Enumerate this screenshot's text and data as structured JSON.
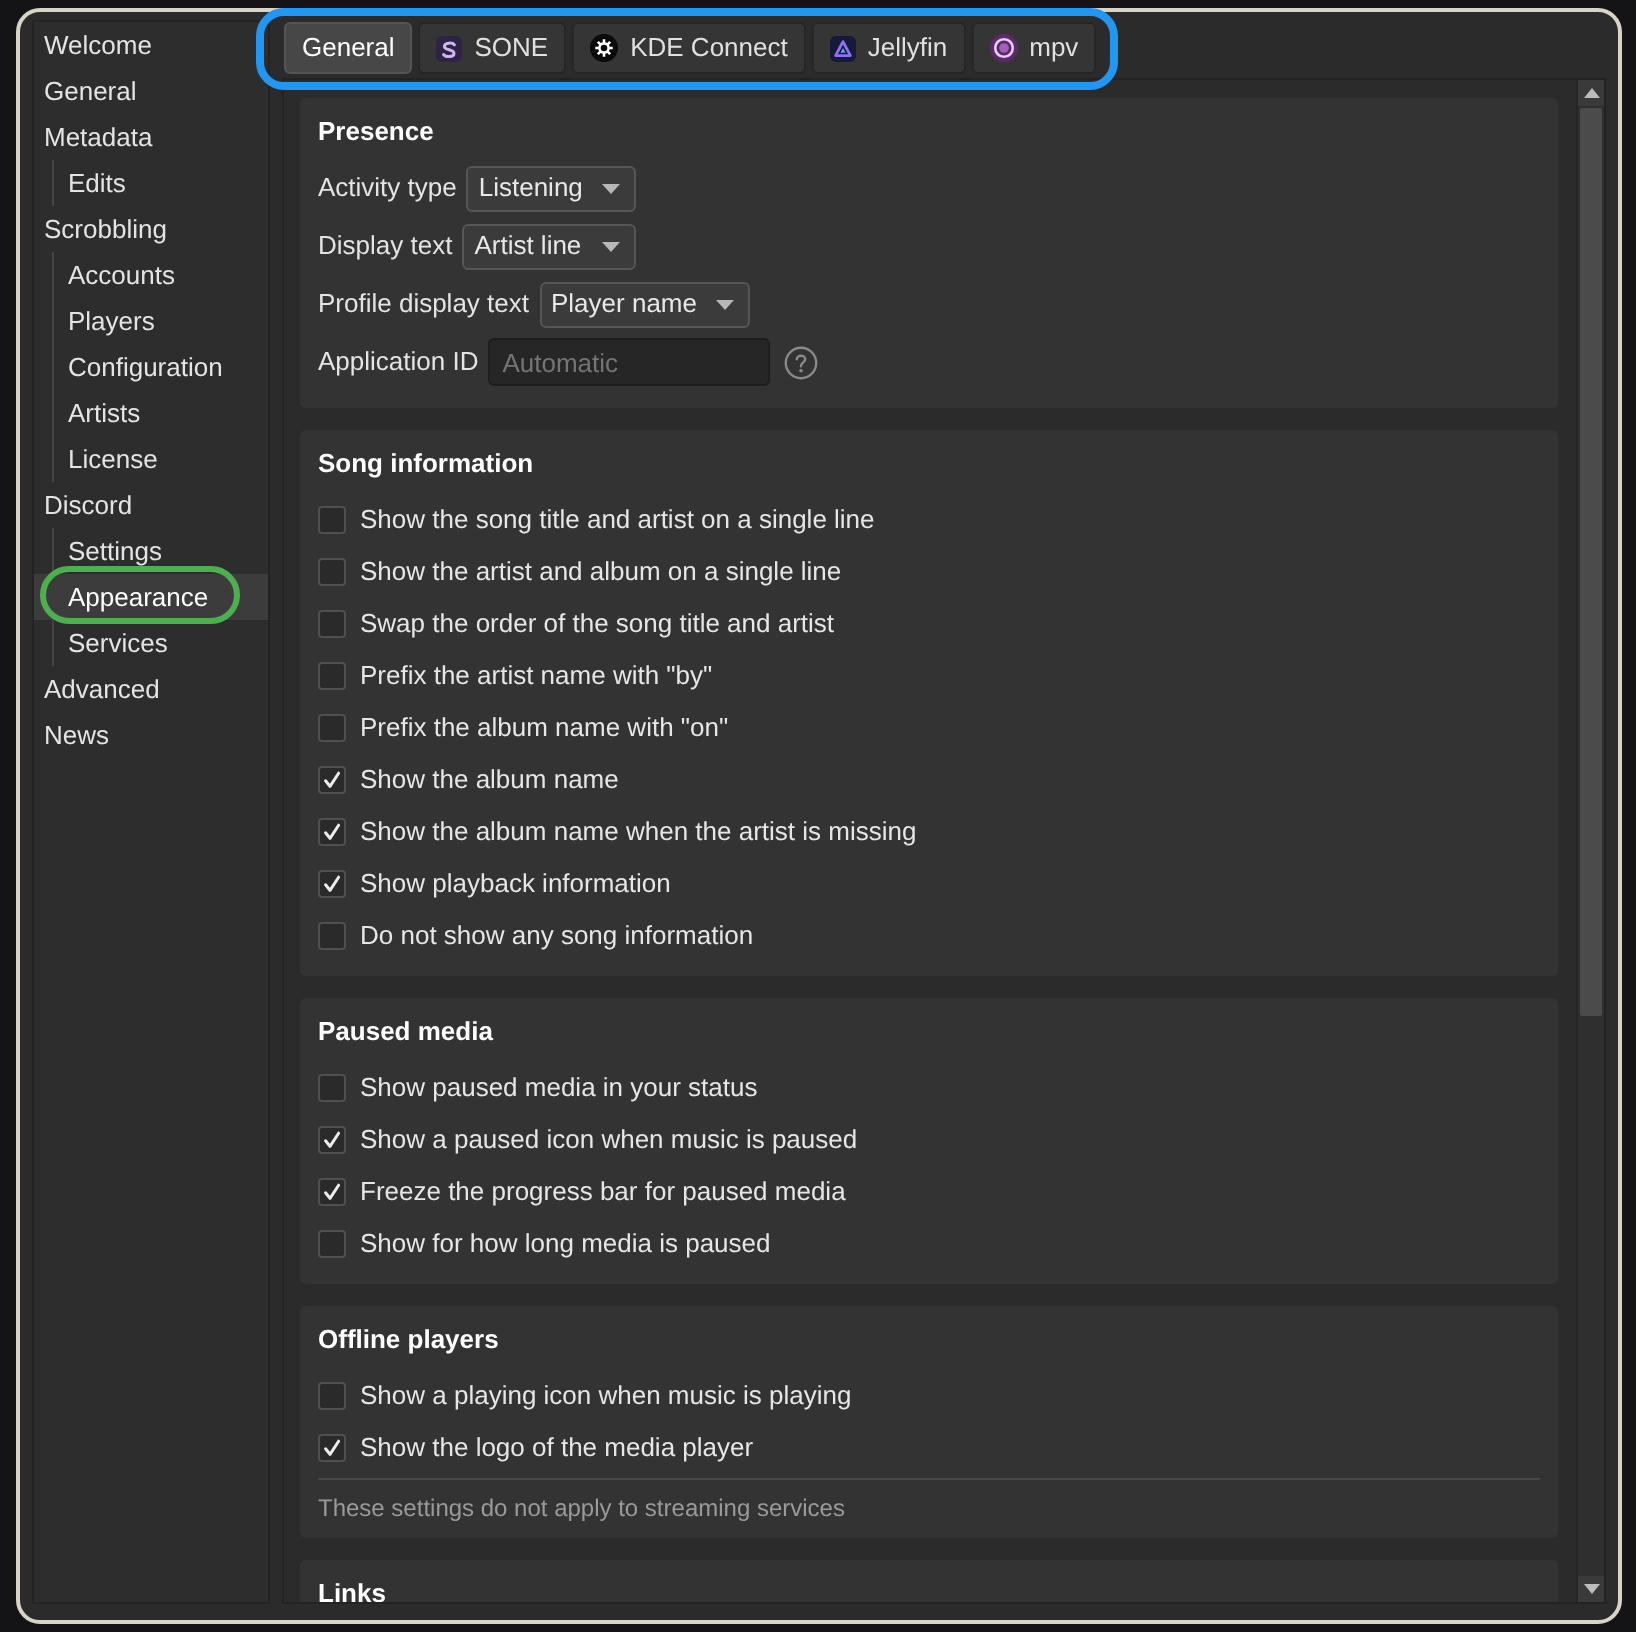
{
  "sidebar": {
    "items": [
      {
        "label": "Welcome",
        "selected": false
      },
      {
        "label": "General",
        "selected": false
      },
      {
        "label": "Metadata",
        "selected": false,
        "children": [
          {
            "label": "Edits",
            "selected": false
          }
        ]
      },
      {
        "label": "Scrobbling",
        "selected": false,
        "children": [
          {
            "label": "Accounts",
            "selected": false
          },
          {
            "label": "Players",
            "selected": false
          },
          {
            "label": "Configuration",
            "selected": false
          },
          {
            "label": "Artists",
            "selected": false
          },
          {
            "label": "License",
            "selected": false
          }
        ]
      },
      {
        "label": "Discord",
        "selected": false,
        "children": [
          {
            "label": "Settings",
            "selected": false
          },
          {
            "label": "Appearance",
            "selected": true
          },
          {
            "label": "Services",
            "selected": false
          }
        ]
      },
      {
        "label": "Advanced",
        "selected": false
      },
      {
        "label": "News",
        "selected": false
      }
    ]
  },
  "tabs": [
    {
      "label": "General",
      "kind": "plain",
      "selected": true
    },
    {
      "label": "SONE",
      "kind": "tile",
      "selected": false
    },
    {
      "label": "KDE Connect",
      "kind": "gear",
      "selected": false
    },
    {
      "label": "Jellyfin",
      "kind": "triangle",
      "selected": false
    },
    {
      "label": "mpv",
      "kind": "ring",
      "selected": false
    }
  ],
  "sections": [
    {
      "title": "Presence",
      "fields": [
        {
          "kind": "dropdown",
          "label": "Activity type",
          "value": "Listening"
        },
        {
          "kind": "dropdown",
          "label": "Display text",
          "value": "Artist line"
        },
        {
          "kind": "dropdown",
          "label": "Profile display text",
          "value": "Player name"
        },
        {
          "kind": "input",
          "label": "Application ID",
          "placeholder": "Automatic",
          "help": true
        }
      ]
    },
    {
      "title": "Song information",
      "options": [
        {
          "label": "Show the song title and artist on a single line",
          "checked": false
        },
        {
          "label": "Show the artist and album on a single line",
          "checked": false
        },
        {
          "label": "Swap the order of the song title and artist",
          "checked": false
        },
        {
          "label": "Prefix the artist name with \"by\"",
          "checked": false
        },
        {
          "label": "Prefix the album name with \"on\"",
          "checked": false
        },
        {
          "label": "Show the album name",
          "checked": true
        },
        {
          "label": "Show the album name when the artist is missing",
          "checked": true
        },
        {
          "label": "Show playback information",
          "checked": true
        },
        {
          "label": "Do not show any song information",
          "checked": false
        }
      ]
    },
    {
      "title": "Paused media",
      "options": [
        {
          "label": "Show paused media in your status",
          "checked": false
        },
        {
          "label": "Show a paused icon when music is paused",
          "checked": true
        },
        {
          "label": "Freeze the progress bar for paused media",
          "checked": true
        },
        {
          "label": "Show for how long media is paused",
          "checked": false
        }
      ]
    },
    {
      "title": "Offline players",
      "options": [
        {
          "label": "Show a playing icon when music is playing",
          "checked": false
        },
        {
          "label": "Show the logo of the media player",
          "checked": true
        }
      ],
      "note": "These settings do not apply to streaming services"
    },
    {
      "title": "Links"
    }
  ],
  "highlights": [
    {
      "kind": "frame",
      "color": "#2196f3"
    },
    {
      "kind": "oval",
      "color": "#4caf50"
    }
  ]
}
